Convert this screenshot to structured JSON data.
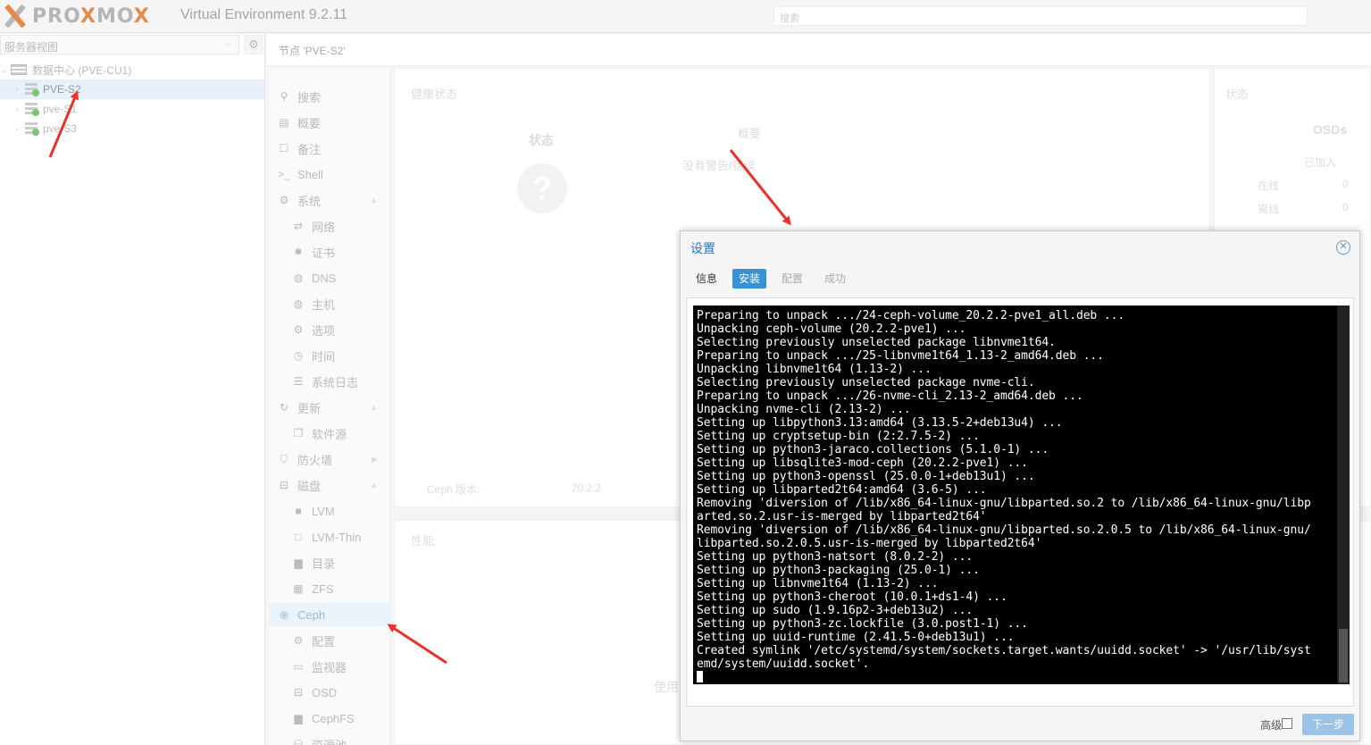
{
  "header": {
    "logo_text_before": "PRO",
    "logo_text_x": "X",
    "logo_text_after": "MO",
    "logo_text_end": "X",
    "version": "Virtual Environment 9.2.11",
    "search_placeholder": "搜索"
  },
  "left_panel": {
    "view_select": "服务器视图",
    "tree": [
      {
        "label": "数据中心 (PVE-CU1)",
        "type": "datacenter"
      },
      {
        "label": "PVE-S2",
        "type": "node",
        "selected": true
      },
      {
        "label": "pve-S1",
        "type": "node"
      },
      {
        "label": "pve-S3",
        "type": "node"
      }
    ]
  },
  "breadcrumb": "节点 'PVE-S2'",
  "nav": {
    "items": [
      {
        "label": "搜索",
        "icon": "search-icon"
      },
      {
        "label": "概要",
        "icon": "book-icon"
      },
      {
        "label": "备注",
        "icon": "note-icon"
      },
      {
        "label": "Shell",
        "icon": "terminal-icon"
      },
      {
        "label": "系统",
        "icon": "cogs-icon"
      },
      {
        "label": "网络",
        "icon": "exchange-icon"
      },
      {
        "label": "证书",
        "icon": "certificate-icon"
      },
      {
        "label": "DNS",
        "icon": "globe-icon"
      },
      {
        "label": "主机",
        "icon": "globe-icon"
      },
      {
        "label": "选项",
        "icon": "gear-icon"
      },
      {
        "label": "时间",
        "icon": "clock-icon"
      },
      {
        "label": "系统日志",
        "icon": "list-icon"
      },
      {
        "label": "更新",
        "icon": "refresh-icon"
      },
      {
        "label": "软件源",
        "icon": "files-icon"
      },
      {
        "label": "防火墙",
        "icon": "shield-icon"
      },
      {
        "label": "磁盘",
        "icon": "hdd-icon"
      },
      {
        "label": "LVM",
        "icon": "square-icon"
      },
      {
        "label": "LVM-Thin",
        "icon": "square-outline-icon"
      },
      {
        "label": "目录",
        "icon": "folder-icon"
      },
      {
        "label": "ZFS",
        "icon": "grid-icon"
      },
      {
        "label": "Ceph",
        "icon": "ceph-icon"
      },
      {
        "label": "配置",
        "icon": "gear-icon"
      },
      {
        "label": "监视器",
        "icon": "monitor-icon"
      },
      {
        "label": "OSD",
        "icon": "hdd-icon"
      },
      {
        "label": "CephFS",
        "icon": "folder-icon"
      },
      {
        "label": "资源池",
        "icon": "pool-icon"
      }
    ]
  },
  "background": {
    "health_title": "健康状态",
    "status_label": "状态",
    "summary_label": "概要",
    "no_warning": "没有警告/错误",
    "status_title": "状态",
    "osds_title": "OSDs",
    "joined": "已加入",
    "online": "在线",
    "offline": "离线",
    "online_val": "0",
    "offline_val": "0",
    "ceph_version_label": "Ceph 版本:",
    "ceph_version": "20.2.2",
    "performance": "性能",
    "usage": "使用"
  },
  "dialog": {
    "title": "设置",
    "tabs": [
      "信息",
      "安装",
      "配置",
      "成功"
    ],
    "active_tab": 1,
    "console_lines": [
      "Preparing to unpack .../24-ceph-volume_20.2.2-pve1_all.deb ...",
      "Unpacking ceph-volume (20.2.2-pve1) ...",
      "Selecting previously unselected package libnvme1t64.",
      "Preparing to unpack .../25-libnvme1t64_1.13-2_amd64.deb ...",
      "Unpacking libnvme1t64 (1.13-2) ...",
      "Selecting previously unselected package nvme-cli.",
      "Preparing to unpack .../26-nvme-cli_2.13-2_amd64.deb ...",
      "Unpacking nvme-cli (2.13-2) ...",
      "Setting up libpython3.13:amd64 (3.13.5-2+deb13u4) ...",
      "Setting up cryptsetup-bin (2:2.7.5-2) ...",
      "Setting up python3-jaraco.collections (5.1.0-1) ...",
      "Setting up libsqlite3-mod-ceph (20.2.2-pve1) ...",
      "Setting up python3-openssl (25.0.0-1+deb13u1) ...",
      "Setting up libparted2t64:amd64 (3.6-5) ...",
      "Removing 'diversion of /lib/x86_64-linux-gnu/libparted.so.2 to /lib/x86_64-linux-gnu/libp",
      "arted.so.2.usr-is-merged by libparted2t64'",
      "Removing 'diversion of /lib/x86_64-linux-gnu/libparted.so.2.0.5 to /lib/x86_64-linux-gnu/",
      "libparted.so.2.0.5.usr-is-merged by libparted2t64'",
      "Setting up python3-natsort (8.0.2-2) ...",
      "Setting up python3-packaging (25.0-1) ...",
      "Setting up libnvme1t64 (1.13-2) ...",
      "Setting up python3-cheroot (10.0.1+ds1-4) ...",
      "Setting up sudo (1.9.16p2-3+deb13u2) ...",
      "Setting up python3-zc.lockfile (3.0.post1-1) ...",
      "Setting up uuid-runtime (2.41.5-0+deb13u1) ...",
      "Created symlink '/etc/systemd/system/sockets.target.wants/uuidd.socket' -> '/usr/lib/syst",
      "emd/system/uuidd.socket'."
    ],
    "advanced_label": "高级",
    "next_label": "下一步"
  }
}
